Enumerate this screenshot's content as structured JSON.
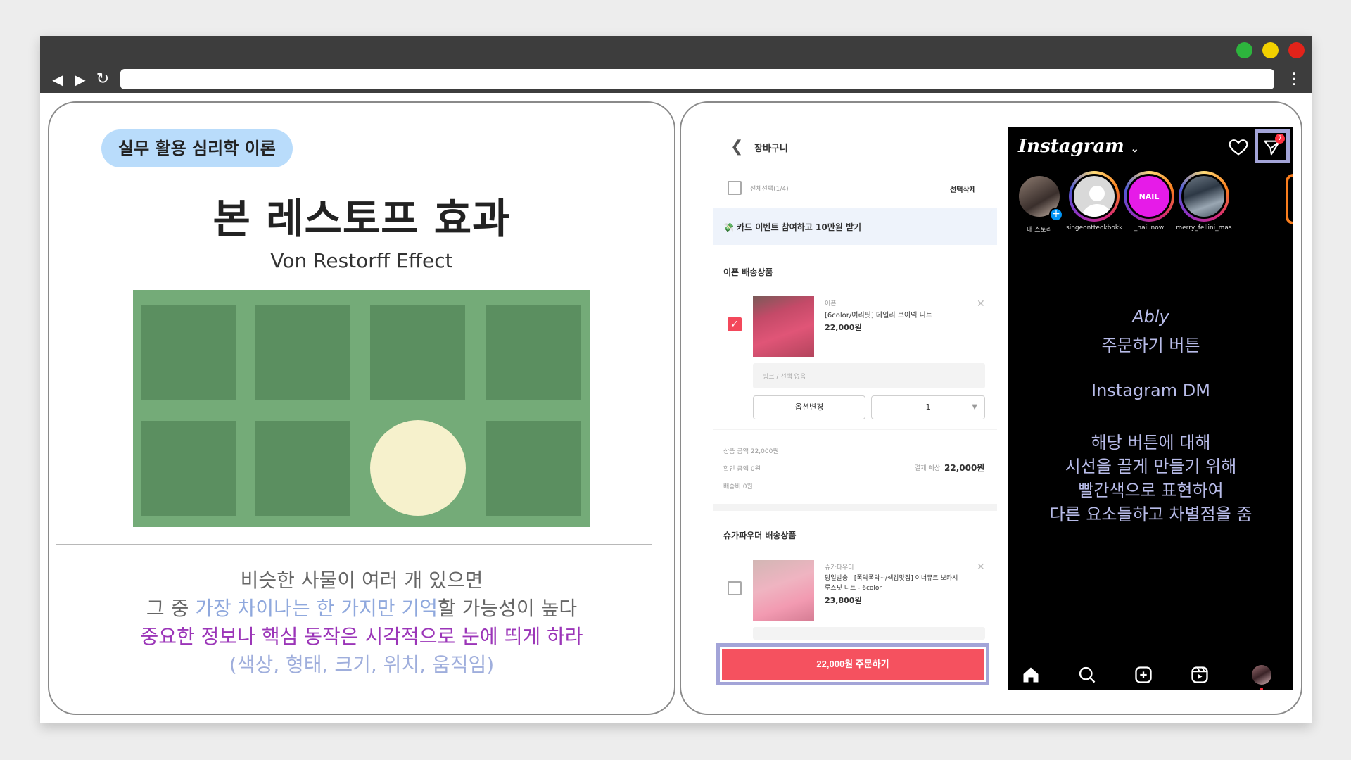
{
  "colors": {
    "tag_bg": "#b9dcfb",
    "highlight_blue": "#8fa8dd",
    "highlight_purple": "#9b35b8",
    "green_bg": "#74ab78",
    "green_cell": "#5b8f60",
    "circle": "#f6f1cc",
    "order_button": "#f5515f",
    "frame": "#a3a4d8"
  },
  "browser": {
    "back_icon": "back-arrow-icon",
    "forward_icon": "forward-arrow-icon",
    "reload_icon": "reload-icon",
    "menu_icon": "kebab-menu-icon"
  },
  "left": {
    "tag": "실무 활용 심리학 이론",
    "title": "본 레스토프 효과",
    "subtitle": "Von Restorff Effect",
    "line1": "비슷한 사물이 여러 개 있으면",
    "line2_a": "그 중 ",
    "line2_hl": "가장 차이나는 한 가지만 기억",
    "line2_b": "할 가능성이 높다",
    "line3": "중요한 정보나 핵심 동작은 시각적으로 눈에 띄게 하라",
    "line4": "(색상, 형태, 크기, 위치, 움직임)"
  },
  "cart": {
    "title": "장바구니",
    "select_all": "전체선택(1/4)",
    "delete_selected": "선택삭제",
    "banner": "💸 카드 이벤트 참여하고 10만원 받기",
    "section1": "이픈 배송상품",
    "item1": {
      "brand": "이픈",
      "name": "[6color/여리핏] 데일리 브이넥 니트",
      "price": "22,000원",
      "option": "핑크 / 선택 없음",
      "change_option": "옵션변경",
      "qty": "1"
    },
    "summary": {
      "product_amount": "상품 금액  22,000원",
      "discount_amount": "할인 금액  0원",
      "shipping": "배송비  0원",
      "expected_label": "결제 예상",
      "expected_value": "22,000원"
    },
    "section2": "슈가파우더 배송상품",
    "item2": {
      "brand": "슈가파우더",
      "name_1": "당일발송 | [폭닥폭닥~/색감맛집] 이너뮤트 보카시",
      "name_2": "루즈핏 니트 - 6color",
      "price": "23,800원"
    },
    "order_button": "22,000원 주문하기"
  },
  "instagram": {
    "logo": "Instagram",
    "dm_badge": "7",
    "stories": [
      {
        "name": "내 스토리"
      },
      {
        "name": "singeontteokbokki"
      },
      {
        "name": "_nail.now",
        "label": "NAIL NOW"
      },
      {
        "name": "merry_fellini_mas"
      }
    ],
    "text_1": "Ably",
    "text_2": "주문하기 버튼",
    "text_3": "Instagram DM",
    "text_4": "해당 버튼에 대해",
    "text_5": "시선을 끌게 만들기 위해",
    "text_6": "빨간색으로 표현하여",
    "text_7": "다른 요소들하고 차별점을 줌"
  }
}
